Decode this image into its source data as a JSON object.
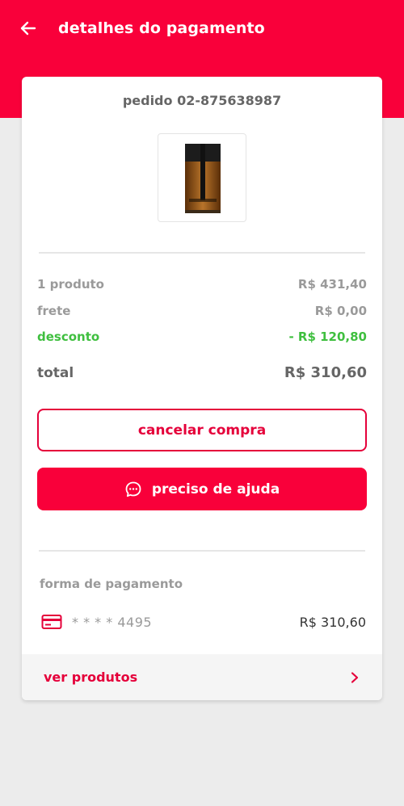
{
  "header": {
    "title": "detalhes do pagamento",
    "back_icon": "arrow-left-icon",
    "background_color": "#f9003a"
  },
  "order": {
    "label": "pedido 02-875638987",
    "product_image": "perfume-bottle"
  },
  "summary": {
    "products_label": "1 produto",
    "products_value": "R$ 431,40",
    "shipping_label": "frete",
    "shipping_value": "R$ 0,00",
    "discount_label": "desconto",
    "discount_value": "- R$ 120,80",
    "discount_color": "#3fbf3f",
    "total_label": "total",
    "total_value": "R$ 310,60"
  },
  "actions": {
    "cancel_label": "cancelar compra",
    "help_label": "preciso de ajuda",
    "help_icon": "chat-bubble-icon",
    "accent_color": "#e5003a"
  },
  "payment": {
    "section_label": "forma de pagamento",
    "card_icon": "credit-card-icon",
    "card_number": "* * * * 4495",
    "amount": "R$ 310,60"
  },
  "footer": {
    "label": "ver produtos",
    "chevron_icon": "chevron-right-icon"
  }
}
